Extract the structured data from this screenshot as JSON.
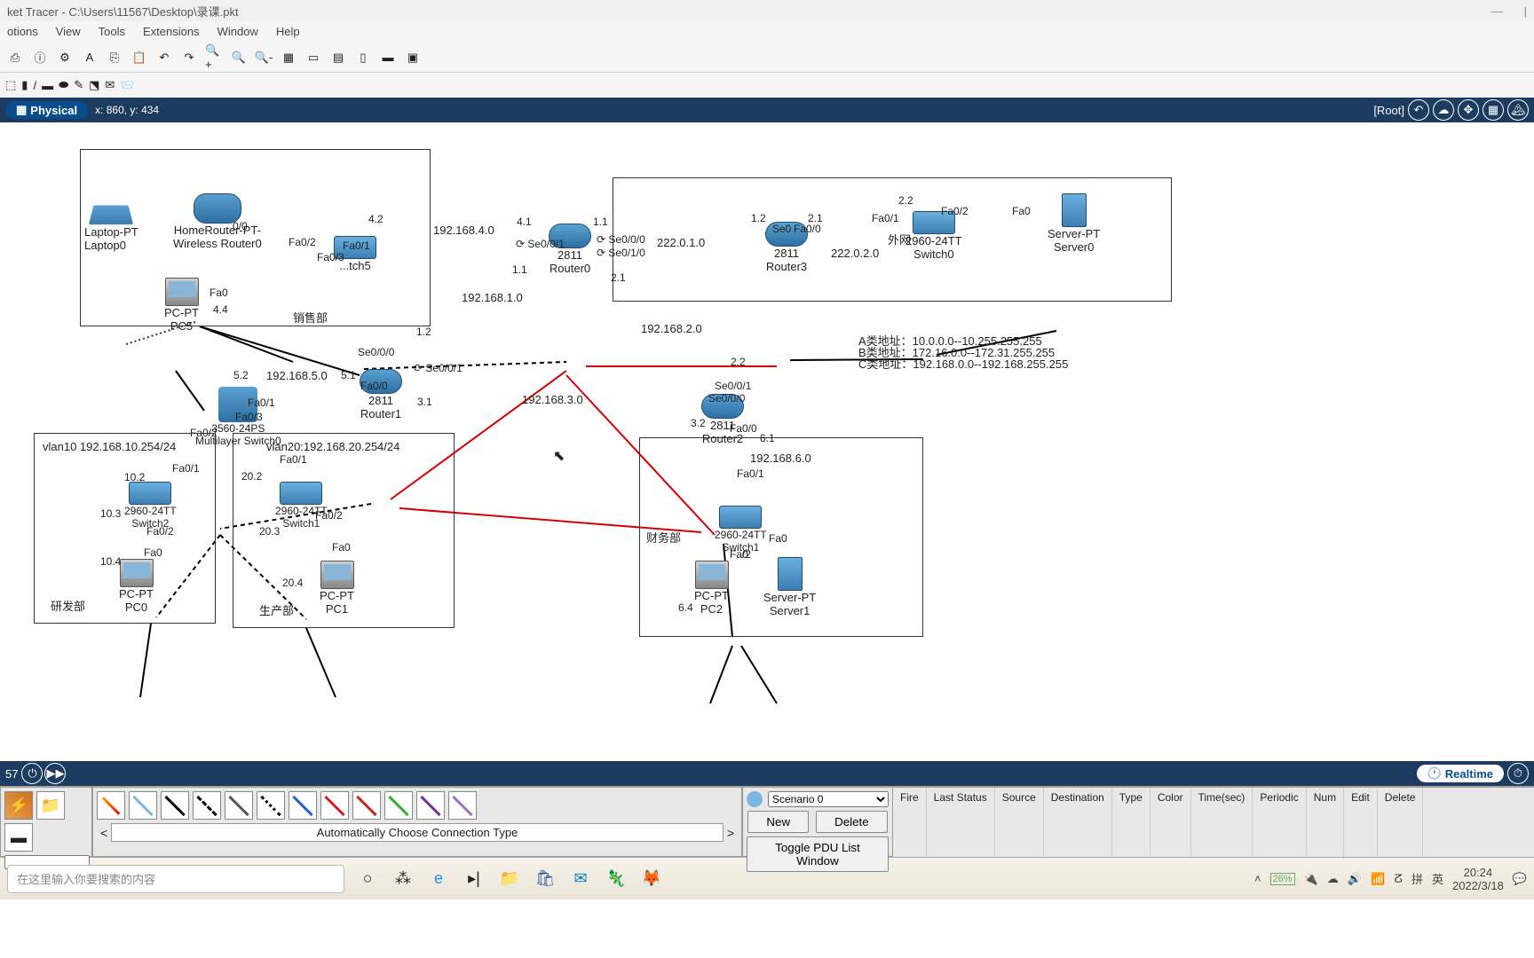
{
  "title": "ket Tracer - C:\\Users\\11567\\Desktop\\录课.pkt",
  "menu": [
    "otions",
    "View",
    "Tools",
    "Extensions",
    "Window",
    "Help"
  ],
  "view": {
    "tab": "Physical",
    "coords": "x: 860, y: 434",
    "root": "[Root]",
    "time": "57"
  },
  "rt": "Realtime",
  "notes": {
    "a": "A类地址：10.0.0.0--10.255.255.255",
    "b": "B类地址：172.16.0.0--172.31.255.255",
    "c": "C类地址：192.168.0.0--192.168.255.255"
  },
  "depts": {
    "sales": "销售部",
    "rd": "研发部",
    "prod": "生产部",
    "fin": "财务部"
  },
  "nets": {
    "n4": "192.168.4.0",
    "n1": "192.168.1.0",
    "n5": "192.168.5.0",
    "n2": "192.168.2.0",
    "n3": "192.168.3.0",
    "n6": "192.168.6.0",
    "w1": "222.0.1.0",
    "w2": "222.0.2.0"
  },
  "dev": {
    "laptop": "Laptop-PT\nLaptop0",
    "wr": "HomeRouter-PT-\nWireless Router0",
    "pc5": "PC-PT\nPC5",
    "sw5": "...tch5",
    "r0": "2811\nRouter0",
    "r3": "2811\nRouter3",
    "sw0": "2960-24TT\nSwitch0",
    "srv0": "Server-PT\nServer0",
    "ext": "外网",
    "r1": "2811\nRouter1",
    "r2": "2811\nRouter2",
    "l3": "3560-24PS\nMultilayer Switch0",
    "sw2": "2960-24TT\nSwitch2",
    "sw1s": "2960-24TT\nSwitch1",
    "sw1f": "2960-24TT\nSwitch1",
    "pc0": "PC-PT\nPC0",
    "pc1": "PC-PT\nPC1",
    "pc2": "PC-PT\nPC2",
    "srv1": "Server-PT\nServer1"
  },
  "vlan": {
    "v10": "vlan10 192.168.10.254/24",
    "v20": "vlan20:192.168.20.254/24"
  },
  "pl": {
    "scenario": "Scenario 0",
    "new": "New",
    "del": "Delete",
    "toggle": "Toggle PDU List Window",
    "auto": "Automatically Choose Connection Type"
  },
  "cols": [
    "Fire",
    "Last Status",
    "Source",
    "Destination",
    "Type",
    "Color",
    "Time(sec)",
    "Periodic",
    "Num",
    "Edit",
    "Delete"
  ],
  "tb": {
    "search": "在这里输入你要搜索的内容",
    "ime": "英",
    "time": "20:24",
    "date": "2022/3/18",
    "batt": "26%"
  }
}
